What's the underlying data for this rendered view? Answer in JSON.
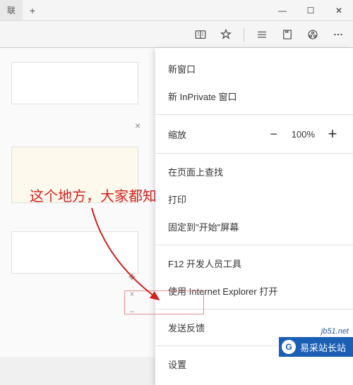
{
  "titlebar": {
    "tab_label": "联",
    "newtab": "+",
    "minimize": "—",
    "maximize": "☐",
    "close": "✕"
  },
  "toolbar": {
    "read_icon": "read-icon",
    "fav_icon": "star-icon",
    "hub_icon": "hamburger-icon",
    "note_icon": "note-icon",
    "share_icon": "share-icon",
    "more_icon": "more-icon"
  },
  "menu": {
    "new_window": "新窗口",
    "inprivate": "新 InPrivate 窗口",
    "zoom_label": "缩放",
    "zoom_minus": "−",
    "zoom_value": "100%",
    "zoom_plus": "+",
    "find": "在页面上查找",
    "print": "打印",
    "pin": "固定到\"开始\"屏幕",
    "f12": "F12 开发人员工具",
    "open_ie": "使用 Internet Explorer 打开",
    "feedback": "发送反馈",
    "settings": "设置"
  },
  "overlay": {
    "annotation": "这个地方，大家都知道的",
    "close_x": "×",
    "move": "✥",
    "x2": "×",
    "dash": "–"
  },
  "footer": {
    "watermark": "jb51.net",
    "logo_text": "易采站长站",
    "logo_glyph": "G"
  }
}
